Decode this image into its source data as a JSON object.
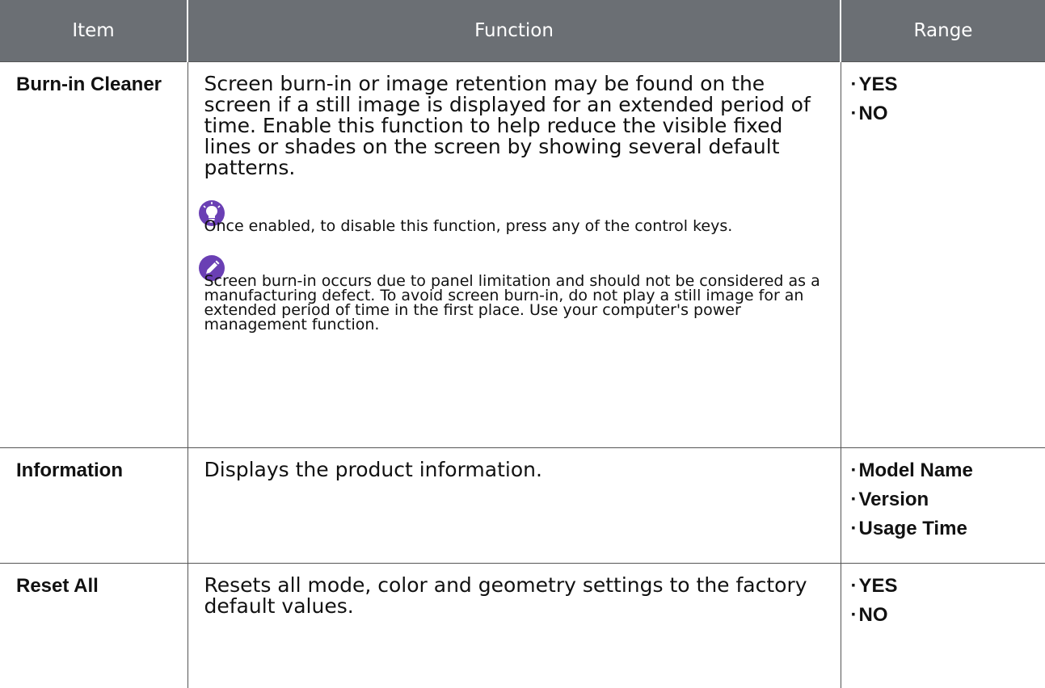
{
  "header": {
    "item": "Item",
    "function": "Function",
    "range": "Range"
  },
  "rows": [
    {
      "item": "Burn-in Cleaner",
      "function": "Screen burn-in or image retention may be found on the screen if a still image is displayed for an extended period of time. Enable this function to help reduce the visible fixed lines or shades on the screen by showing several default patterns.",
      "tip": {
        "icon": "lightbulb-icon",
        "text": "Once enabled, to disable this function, press any of the control keys."
      },
      "note": {
        "icon": "pencil-icon",
        "text": "Screen burn-in occurs due to panel limitation and should not be considered as a manufacturing defect. To avoid screen burn-in, do not play a still image for an extended period of time in the first place. Use your computer's power management function."
      },
      "range": [
        "YES",
        "NO"
      ]
    },
    {
      "item": "Information",
      "function": "Displays the product information.",
      "range": [
        "Model Name",
        "Version",
        "Usage Time"
      ]
    },
    {
      "item": "Reset All",
      "function": "Resets all mode, color and geometry settings to the factory default values.",
      "range": [
        "YES",
        "NO"
      ]
    }
  ],
  "colors": {
    "header_bg": "#6b6f74",
    "icon_purple": "#6a3fb4",
    "border": "#555555"
  }
}
